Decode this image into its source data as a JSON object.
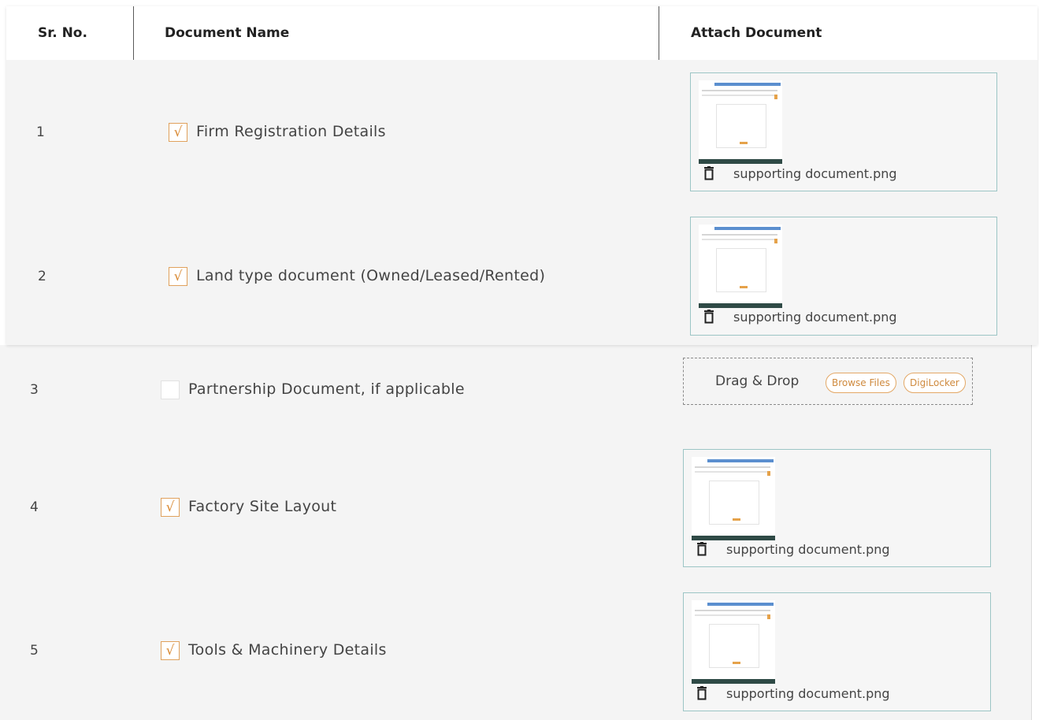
{
  "table": {
    "headers": {
      "sr_no": "Sr. No.",
      "document_name": "Document Name",
      "attach_document": "Attach Document"
    },
    "rows": [
      {
        "sr": "1",
        "name": "Firm Registration Details",
        "checked": true,
        "file": "supporting document.png"
      },
      {
        "sr": "2",
        "name": "Land type document (Owned/Leased/Rented)",
        "checked": true,
        "file": "supporting document.png"
      },
      {
        "sr": "3",
        "name": "Partnership Document, if applicable",
        "checked": false,
        "file": ""
      },
      {
        "sr": "4",
        "name": "Factory Site Layout",
        "checked": true,
        "file": "supporting document.png"
      },
      {
        "sr": "5",
        "name": "Tools & Machinery Details",
        "checked": true,
        "file": "supporting document.png"
      }
    ]
  },
  "upload": {
    "drag_drop_label": "Drag & Drop",
    "browse_label": "Browse Files",
    "digilocker_label": "DigiLocker"
  },
  "icons": {
    "checkbox_checked": "checkmark-icon",
    "delete": "trash-icon"
  },
  "colors": {
    "accent": "#d98a34",
    "attach_border": "#9cc5c5",
    "panel_bg": "#f4f4f4"
  },
  "glyphs": {
    "check": "√"
  }
}
